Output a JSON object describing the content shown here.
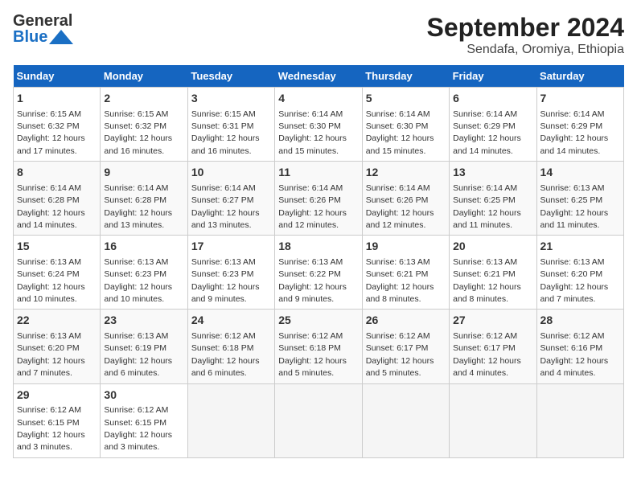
{
  "header": {
    "logo_general": "General",
    "logo_blue": "Blue",
    "title": "September 2024",
    "subtitle": "Sendafa, Oromiya, Ethiopia"
  },
  "columns": [
    "Sunday",
    "Monday",
    "Tuesday",
    "Wednesday",
    "Thursday",
    "Friday",
    "Saturday"
  ],
  "weeks": [
    [
      {
        "day": "1",
        "info": "Sunrise: 6:15 AM\nSunset: 6:32 PM\nDaylight: 12 hours\nand 17 minutes."
      },
      {
        "day": "2",
        "info": "Sunrise: 6:15 AM\nSunset: 6:32 PM\nDaylight: 12 hours\nand 16 minutes."
      },
      {
        "day": "3",
        "info": "Sunrise: 6:15 AM\nSunset: 6:31 PM\nDaylight: 12 hours\nand 16 minutes."
      },
      {
        "day": "4",
        "info": "Sunrise: 6:14 AM\nSunset: 6:30 PM\nDaylight: 12 hours\nand 15 minutes."
      },
      {
        "day": "5",
        "info": "Sunrise: 6:14 AM\nSunset: 6:30 PM\nDaylight: 12 hours\nand 15 minutes."
      },
      {
        "day": "6",
        "info": "Sunrise: 6:14 AM\nSunset: 6:29 PM\nDaylight: 12 hours\nand 14 minutes."
      },
      {
        "day": "7",
        "info": "Sunrise: 6:14 AM\nSunset: 6:29 PM\nDaylight: 12 hours\nand 14 minutes."
      }
    ],
    [
      {
        "day": "8",
        "info": "Sunrise: 6:14 AM\nSunset: 6:28 PM\nDaylight: 12 hours\nand 14 minutes."
      },
      {
        "day": "9",
        "info": "Sunrise: 6:14 AM\nSunset: 6:28 PM\nDaylight: 12 hours\nand 13 minutes."
      },
      {
        "day": "10",
        "info": "Sunrise: 6:14 AM\nSunset: 6:27 PM\nDaylight: 12 hours\nand 13 minutes."
      },
      {
        "day": "11",
        "info": "Sunrise: 6:14 AM\nSunset: 6:26 PM\nDaylight: 12 hours\nand 12 minutes."
      },
      {
        "day": "12",
        "info": "Sunrise: 6:14 AM\nSunset: 6:26 PM\nDaylight: 12 hours\nand 12 minutes."
      },
      {
        "day": "13",
        "info": "Sunrise: 6:14 AM\nSunset: 6:25 PM\nDaylight: 12 hours\nand 11 minutes."
      },
      {
        "day": "14",
        "info": "Sunrise: 6:13 AM\nSunset: 6:25 PM\nDaylight: 12 hours\nand 11 minutes."
      }
    ],
    [
      {
        "day": "15",
        "info": "Sunrise: 6:13 AM\nSunset: 6:24 PM\nDaylight: 12 hours\nand 10 minutes."
      },
      {
        "day": "16",
        "info": "Sunrise: 6:13 AM\nSunset: 6:23 PM\nDaylight: 12 hours\nand 10 minutes."
      },
      {
        "day": "17",
        "info": "Sunrise: 6:13 AM\nSunset: 6:23 PM\nDaylight: 12 hours\nand 9 minutes."
      },
      {
        "day": "18",
        "info": "Sunrise: 6:13 AM\nSunset: 6:22 PM\nDaylight: 12 hours\nand 9 minutes."
      },
      {
        "day": "19",
        "info": "Sunrise: 6:13 AM\nSunset: 6:21 PM\nDaylight: 12 hours\nand 8 minutes."
      },
      {
        "day": "20",
        "info": "Sunrise: 6:13 AM\nSunset: 6:21 PM\nDaylight: 12 hours\nand 8 minutes."
      },
      {
        "day": "21",
        "info": "Sunrise: 6:13 AM\nSunset: 6:20 PM\nDaylight: 12 hours\nand 7 minutes."
      }
    ],
    [
      {
        "day": "22",
        "info": "Sunrise: 6:13 AM\nSunset: 6:20 PM\nDaylight: 12 hours\nand 7 minutes."
      },
      {
        "day": "23",
        "info": "Sunrise: 6:13 AM\nSunset: 6:19 PM\nDaylight: 12 hours\nand 6 minutes."
      },
      {
        "day": "24",
        "info": "Sunrise: 6:12 AM\nSunset: 6:18 PM\nDaylight: 12 hours\nand 6 minutes."
      },
      {
        "day": "25",
        "info": "Sunrise: 6:12 AM\nSunset: 6:18 PM\nDaylight: 12 hours\nand 5 minutes."
      },
      {
        "day": "26",
        "info": "Sunrise: 6:12 AM\nSunset: 6:17 PM\nDaylight: 12 hours\nand 5 minutes."
      },
      {
        "day": "27",
        "info": "Sunrise: 6:12 AM\nSunset: 6:17 PM\nDaylight: 12 hours\nand 4 minutes."
      },
      {
        "day": "28",
        "info": "Sunrise: 6:12 AM\nSunset: 6:16 PM\nDaylight: 12 hours\nand 4 minutes."
      }
    ],
    [
      {
        "day": "29",
        "info": "Sunrise: 6:12 AM\nSunset: 6:15 PM\nDaylight: 12 hours\nand 3 minutes."
      },
      {
        "day": "30",
        "info": "Sunrise: 6:12 AM\nSunset: 6:15 PM\nDaylight: 12 hours\nand 3 minutes."
      },
      {
        "day": "",
        "info": ""
      },
      {
        "day": "",
        "info": ""
      },
      {
        "day": "",
        "info": ""
      },
      {
        "day": "",
        "info": ""
      },
      {
        "day": "",
        "info": ""
      }
    ]
  ]
}
